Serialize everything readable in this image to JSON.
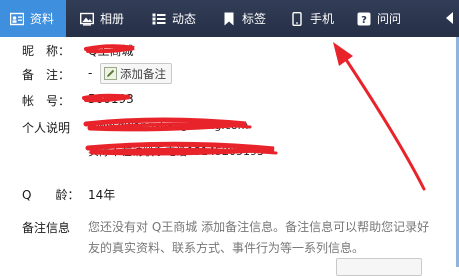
{
  "tabs": [
    {
      "label": "资料",
      "icon": "profile-card-icon",
      "active": true
    },
    {
      "label": "相册",
      "icon": "photo-album-icon",
      "active": false
    },
    {
      "label": "动态",
      "icon": "feed-list-icon",
      "active": false
    },
    {
      "label": "标签",
      "icon": "bookmark-icon",
      "active": false
    },
    {
      "label": "手机",
      "icon": "mobile-phone-icon",
      "active": false
    },
    {
      "label": "问问",
      "icon": "question-icon",
      "active": false
    }
  ],
  "profile": {
    "nickname_label": "昵　称：",
    "nickname_value": "Q王商城",
    "remark_label": "备　注：",
    "remark_value": "-",
    "add_remark_button": "添加备注",
    "account_label": "帐　号：",
    "account_value": "560193",
    "bio_label": "个人说明",
    "bio_line1": "www.qwangshangcheng.com",
    "bio_line2": "实际不在请联系电话13145205193",
    "age_label": "Q　　龄：",
    "age_value": "14年",
    "remark_info_label": "备注信息",
    "remark_info_text": "您还没有对 Q王商城 添加备注信息。备注信息可以帮助您记录好友的真实资料、联系方式、事件行为等一系列信息。"
  },
  "colors": {
    "tab_bar": "#2b3550",
    "tab_active": "#3f8fdf",
    "annotation_red": "#e8232a"
  }
}
